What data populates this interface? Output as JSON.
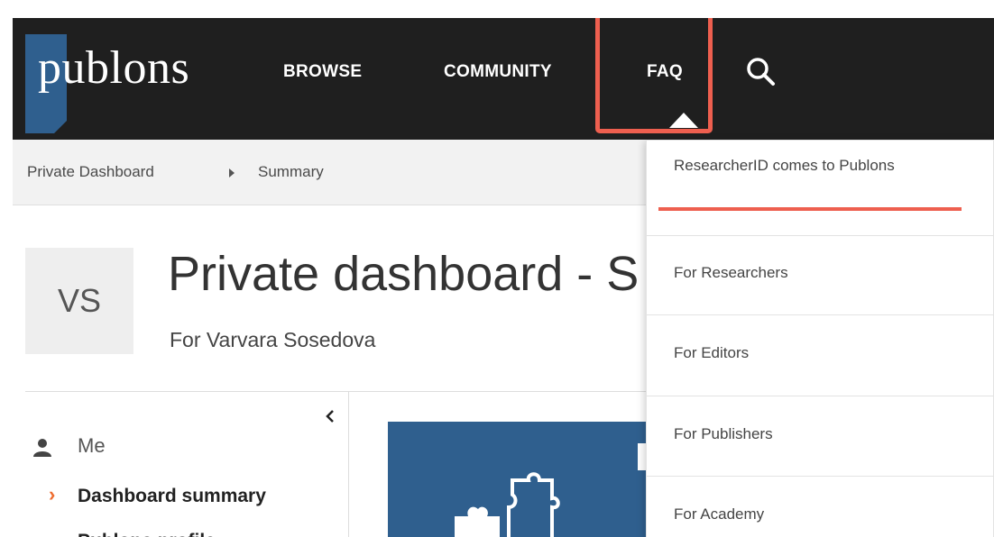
{
  "nav": {
    "logo": "publons",
    "browse": "BROWSE",
    "community": "COMMUNITY",
    "faq": "FAQ"
  },
  "breadcrumb": {
    "item1": "Private Dashboard",
    "item2": "Summary"
  },
  "header": {
    "avatar_initials": "VS",
    "title": "Private dashboard - S",
    "subtitle": "For Varvara Sosedova"
  },
  "sidebar": {
    "section": "Me",
    "active_item": "Dashboard summary",
    "next_item": "Publons profile"
  },
  "faq_menu": {
    "items": [
      "ResearcherID comes to Publons",
      "For Researchers",
      "For Editors",
      "For Publishers",
      "For Academy"
    ]
  },
  "colors": {
    "topnav": "#1f1f1f",
    "brand_blue": "#2f5f8e",
    "highlight": "#ee5f4f",
    "active_chevron": "#ee6c2f"
  },
  "icons": [
    "search-icon",
    "user-icon",
    "chevron-left-icon",
    "chevron-right-icon",
    "puzzle-icon"
  ]
}
